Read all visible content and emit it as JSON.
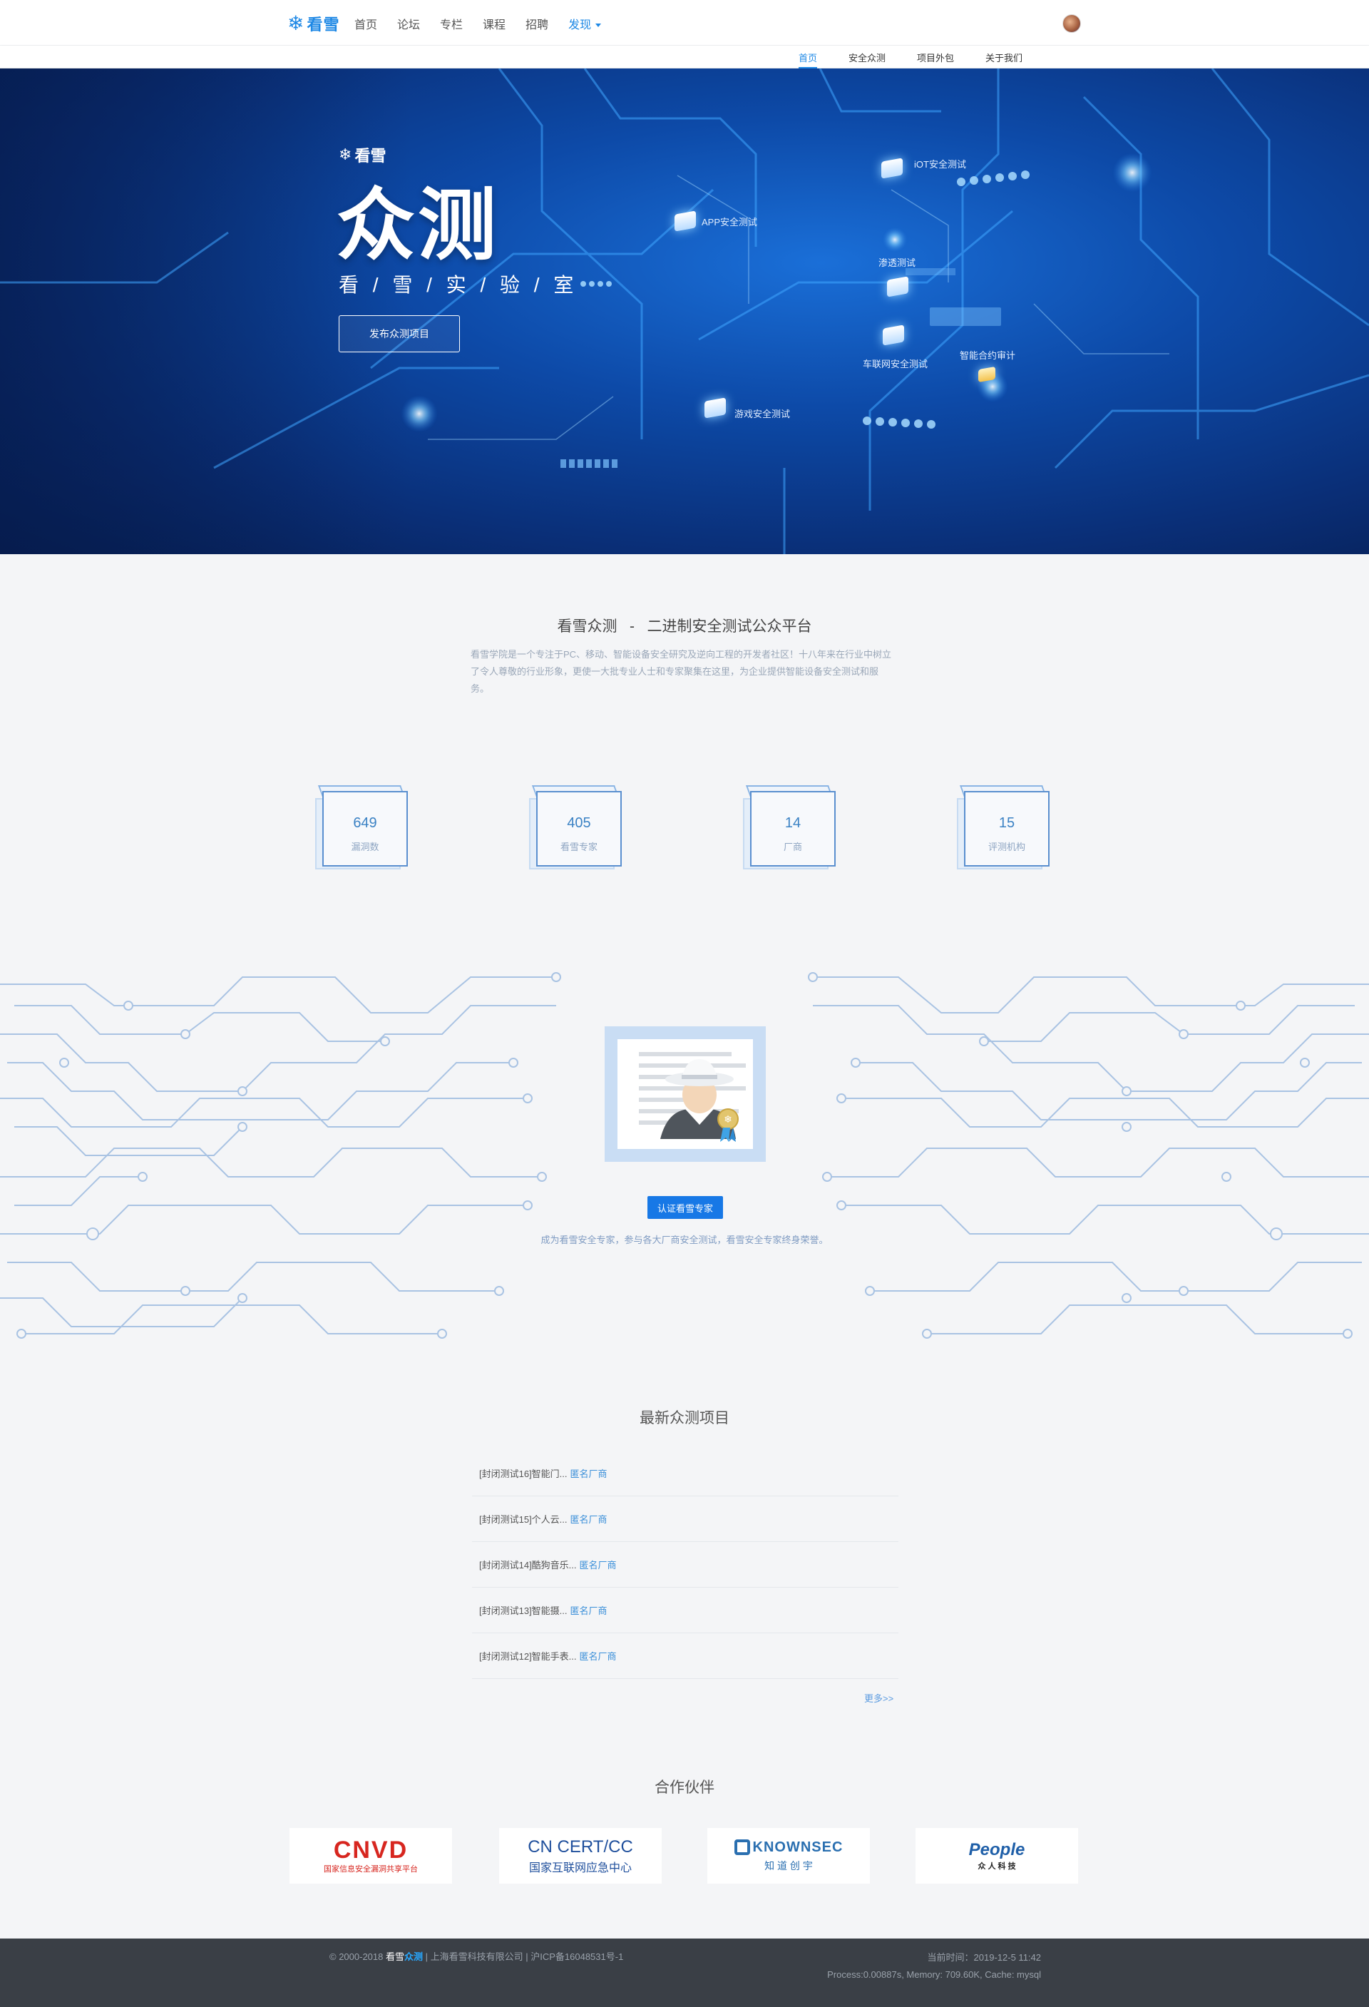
{
  "nav": {
    "logo_text": "看雪",
    "menu": [
      "首页",
      "论坛",
      "专栏",
      "课程",
      "招聘"
    ],
    "discover": "发现"
  },
  "subnav": {
    "items": [
      "首页",
      "安全众测",
      "项目外包",
      "关于我们"
    ],
    "active": "首页"
  },
  "hero": {
    "brand": "看雪",
    "title": "众测",
    "subtitle": "看 / 雪 / 实 / 验 / 室",
    "button": "发布众测项目",
    "labels": [
      "iOT安全测试",
      "APP安全测试",
      "渗透测试",
      "车联网安全测试",
      "智能合约审计",
      "游戏安全测试"
    ]
  },
  "intro": {
    "title": "看雪众测   -   二进制安全测试公众平台",
    "desc": "看雪学院是一个专注于PC、移动、智能设备安全研究及逆向工程的开发者社区！十八年来在行业中树立了令人尊敬的行业形象，更使一大批专业人士和专家聚集在这里，为企业提供智能设备安全测试和服务。"
  },
  "stats": [
    {
      "value": "649",
      "label": "漏洞数"
    },
    {
      "value": "405",
      "label": "看雪专家"
    },
    {
      "value": "14",
      "label": "厂商"
    },
    {
      "value": "15",
      "label": "评测机构"
    }
  ],
  "expert": {
    "button": "认证看雪专家",
    "desc": "成为看雪安全专家，参与各大厂商安全测试，看雪安全专家终身荣誉。"
  },
  "latest": {
    "title": "最新众测项目",
    "items": [
      {
        "name": "[封闭测试16]智能门...",
        "vendor": "匿名厂商"
      },
      {
        "name": "[封闭测试15]个人云...",
        "vendor": "匿名厂商"
      },
      {
        "name": "[封闭测试14]酷狗音乐...",
        "vendor": "匿名厂商"
      },
      {
        "name": "[封闭测试13]智能摄...",
        "vendor": "匿名厂商"
      },
      {
        "name": "[封闭测试12]智能手表...",
        "vendor": "匿名厂商"
      }
    ],
    "more": "更多>>"
  },
  "partners": {
    "title": "合作伙伴",
    "items": [
      {
        "name": "CNVD",
        "sub": "国家信息安全漏洞共享平台",
        "color": "#d7261f"
      },
      {
        "name": "CN CERT/CC",
        "sub": "国家互联网应急中心",
        "color": "#1f4f9c"
      },
      {
        "name": "KNOWNSEC",
        "sub": "知 道 创 宇",
        "color": "#2a6fb0"
      },
      {
        "name": "People",
        "sub": "众 人 科 技",
        "color": "#1f5fa8"
      }
    ]
  },
  "footer": {
    "copyright": "© 2000-2018",
    "brand_a": "看雪",
    "brand_b": "众测",
    "company": " | 上海看雪科技有限公司 | 沪ICP备16048531号-1",
    "time": "当前时间：2019-12-5 11:42",
    "perf": "Process:0.00887s, Memory: 709.60K, Cache: mysql"
  }
}
